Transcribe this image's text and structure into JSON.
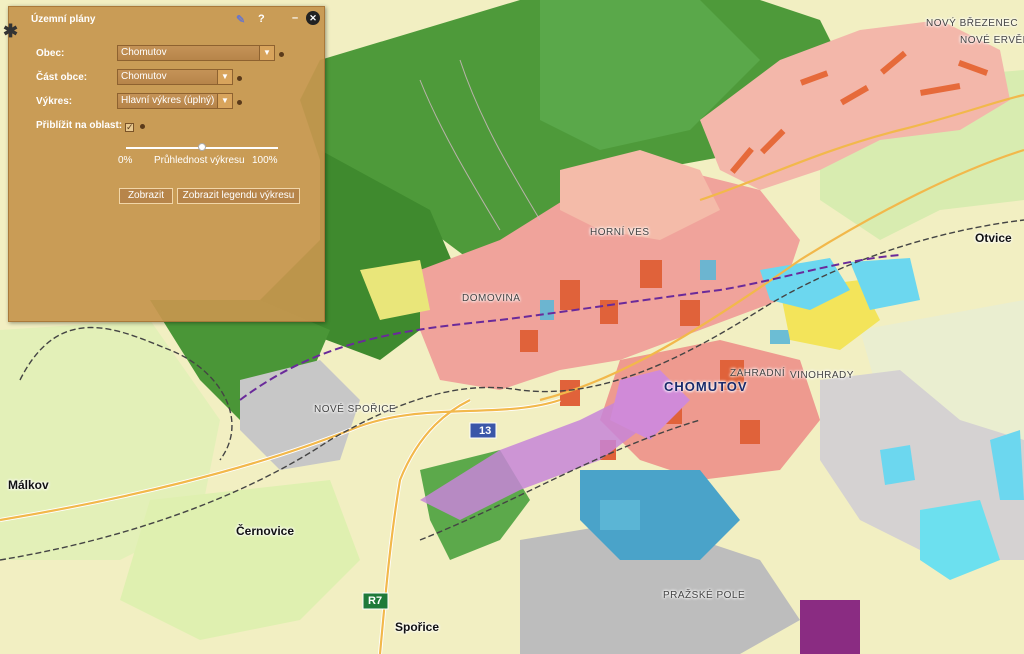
{
  "panel": {
    "title": "Územní plány",
    "help_icon": "?",
    "minimize_icon": "–",
    "close_icon": "✕",
    "obec_label": "Obec:",
    "obec_value": "Chomutov",
    "cast_label": "Část obce:",
    "cast_value": "Chomutov",
    "vykres_label": "Výkres:",
    "vykres_value": "Hlavní výkres (úplný)",
    "priblizit_label": "Přiblížit na oblast:",
    "priblizit_checked": true,
    "slider_min": "0%",
    "slider_label": "Průhlednost výkresu",
    "slider_max": "100%",
    "slider_value": 0.5,
    "btn_show": "Zobrazit",
    "btn_legend": "Zobrazit legendu výkresu"
  },
  "map": {
    "places": {
      "novy_brezenec": "NOVÝ BŘEZENEC",
      "nove_ervenice": "NOVÉ ERVĚNICE",
      "otvice": "Otvice",
      "chomutov": "CHOMUTOV",
      "domovina": "DOMOVINA",
      "novy_sporice": "NOVÉ SPOŘICE",
      "horni_ves": "HORNÍ VES",
      "zahradni": "ZAHRADNÍ",
      "malkov": "Málkov",
      "cernovice": "Černovice",
      "sporice": "Spořice",
      "prazske_pole": "PRAŽSKÉ POLE",
      "vinohrady": "VINOHRADY"
    },
    "road_r7": "R7",
    "road_13": "13"
  }
}
